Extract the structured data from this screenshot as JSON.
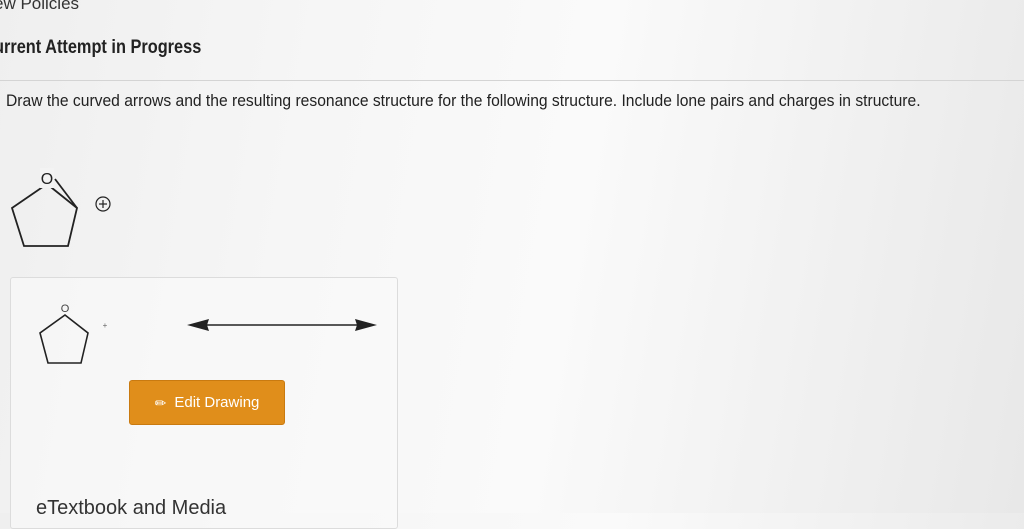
{
  "header": {
    "policies_link": "ew Policies",
    "attempt_title": "urrent Attempt in Progress"
  },
  "question": {
    "text": "Draw the curved arrows and the resulting resonance structure for the following structure. Include lone pairs and charges in structure."
  },
  "structure": {
    "oxygen_label": "O",
    "charge_symbol": "⊕"
  },
  "drawing_area": {
    "oxygen_label": "O",
    "charge_symbol": "+",
    "arrow": "resonance-double-arrow"
  },
  "edit_button": {
    "label": "Edit Drawing",
    "icon": "pencil-icon",
    "color": "#e08e1b"
  },
  "footer": {
    "textbook_link": "eTextbook and Media"
  }
}
